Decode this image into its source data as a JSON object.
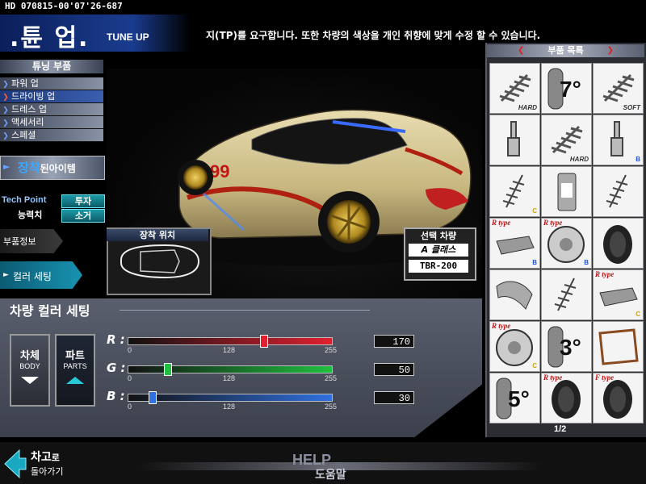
{
  "header": {
    "hd_code": "HD 070815-00'07'26-687",
    "title_ko": ".튠 업.",
    "title_en": "TUNE UP",
    "description": "지(TP)를 요구합니다. 또한 차량의 색상을 개인 취향에 맞게 수정 할 수 있습니다."
  },
  "menu": {
    "title": "튜닝 부품",
    "items": [
      {
        "label": "파워 업",
        "active": false
      },
      {
        "label": "드라이빙 업",
        "active": true
      },
      {
        "label": "드레스 업",
        "active": false
      },
      {
        "label": "액세서리",
        "active": false
      },
      {
        "label": "스페셜",
        "active": false
      }
    ],
    "equipped_main": "장착",
    "equipped_sub": "된아이템",
    "tech_point": "Tech Point",
    "tech_ability": "능력치",
    "invest": "투자",
    "withdraw": "소거",
    "parts_info": "부품정보",
    "color_setting": "컬러 세팅"
  },
  "car": {
    "mount_position": "장착 위치",
    "selected_car": "선택 차량",
    "car_class": "A 클래스",
    "car_model": "TBR-200",
    "number": "99"
  },
  "color_setting": {
    "title": "차량 컬러 세팅",
    "body_ko": "차체",
    "body_en": "BODY",
    "parts_ko": "파트",
    "parts_en": "PARTS",
    "ticks": [
      "0",
      "128",
      "255"
    ],
    "channels": [
      {
        "name": "R :",
        "value": 170,
        "display": "170",
        "color": "#e02030"
      },
      {
        "name": "G :",
        "value": 50,
        "display": "50",
        "color": "#20c040"
      },
      {
        "name": "B :",
        "value": 30,
        "display": "30",
        "color": "#3070e0"
      }
    ]
  },
  "parts_list": {
    "title": "부품 목록",
    "page": "1/2",
    "cells": [
      {
        "icon": "spring-icon",
        "label": "HARD",
        "top_label": "",
        "big": "",
        "badge": ""
      },
      {
        "icon": "tire-tread-icon",
        "label": "",
        "top_label": "",
        "big": "7°",
        "badge": ""
      },
      {
        "icon": "spring-icon",
        "label": "SOFT",
        "top_label": "",
        "big": "",
        "badge": ""
      },
      {
        "icon": "shock-absorber-icon",
        "label": "",
        "top_label": "",
        "big": "",
        "badge": ""
      },
      {
        "icon": "spring-icon",
        "label": "HARD",
        "top_label": "",
        "big": "",
        "badge": ""
      },
      {
        "icon": "shock-absorber-icon",
        "label": "",
        "top_label": "",
        "big": "",
        "badge": "B"
      },
      {
        "icon": "coilover-icon",
        "label": "",
        "top_label": "",
        "big": "",
        "badge": "C"
      },
      {
        "icon": "brake-fluid-icon",
        "label": "",
        "top_label": "",
        "big": "",
        "badge": ""
      },
      {
        "icon": "coilover-icon",
        "label": "",
        "top_label": "",
        "big": "",
        "badge": ""
      },
      {
        "icon": "brake-pad-icon",
        "label": "",
        "top_label": "R type",
        "big": "",
        "badge": "B"
      },
      {
        "icon": "brake-disc-icon",
        "label": "",
        "top_label": "R type",
        "big": "",
        "badge": "B"
      },
      {
        "icon": "tire-icon",
        "label": "",
        "top_label": "",
        "big": "",
        "badge": ""
      },
      {
        "icon": "brake-caliper-icon",
        "label": "",
        "top_label": "",
        "big": "",
        "badge": ""
      },
      {
        "icon": "coilover-icon",
        "label": "",
        "top_label": "",
        "big": "",
        "badge": ""
      },
      {
        "icon": "brake-pad-icon",
        "label": "",
        "top_label": "R type",
        "big": "",
        "badge": "C"
      },
      {
        "icon": "brake-disc-icon",
        "label": "",
        "top_label": "R type",
        "big": "",
        "badge": "C"
      },
      {
        "icon": "tire-tread-icon",
        "label": "",
        "top_label": "",
        "big": "3°",
        "badge": ""
      },
      {
        "icon": "gasket-icon",
        "label": "",
        "top_label": "",
        "big": "",
        "badge": ""
      },
      {
        "icon": "tire-tread-icon",
        "label": "",
        "top_label": "",
        "big": "5°",
        "badge": ""
      },
      {
        "icon": "tire-icon",
        "label": "",
        "top_label": "R type",
        "big": "",
        "badge": ""
      },
      {
        "icon": "tire-icon",
        "label": "",
        "top_label": "F type",
        "big": "",
        "badge": ""
      }
    ]
  },
  "footer": {
    "back_1": "차고",
    "back_1_suffix": "로",
    "back_2": "돌아가기",
    "help_en": "HELP",
    "help_ko": "도움말"
  }
}
